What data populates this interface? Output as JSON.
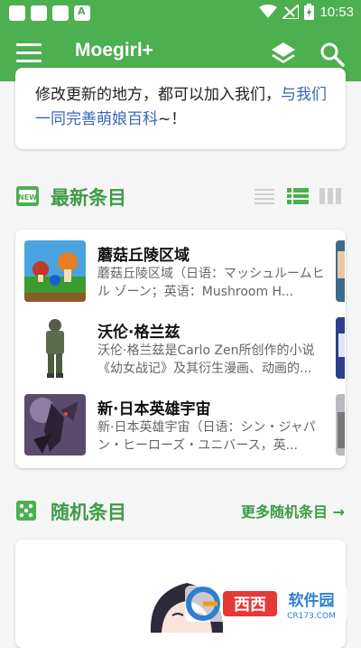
{
  "status_bar": {
    "time": "10:53"
  },
  "app_bar": {
    "title": "Moegirl+"
  },
  "intro": {
    "text": "修改更新的地方，都可以加入我们，",
    "link": "与我们一同完善萌娘百科",
    "suffix": "~！"
  },
  "newest": {
    "title": "最新条目",
    "badge": "NEW",
    "items": [
      {
        "title": "蘑菇丘陵区域",
        "desc": "蘑菇丘陵区域（日语：マッシュルームヒル ゾーン；英语：Mushroom H..."
      },
      {
        "title": "沃伦·格兰兹",
        "desc": "沃伦·格兰兹是Carlo Zen所创作的小说《幼女战记》及其衍生漫画、动画的..."
      },
      {
        "title": "新·日本英雄宇宙",
        "desc": "新·日本英雄宇宙（日语：シン・ジャパン・ヒーローズ・ユニバース，英..."
      }
    ]
  },
  "random": {
    "title": "随机条目",
    "more_label": "更多随机条目 →"
  },
  "watermark": {
    "brand": "西西",
    "tag": "软件园",
    "domain": "CR173.COM"
  },
  "colors": {
    "primary": "#4caf50",
    "accent_text": "#3d9b46",
    "link": "#3a66b5"
  }
}
